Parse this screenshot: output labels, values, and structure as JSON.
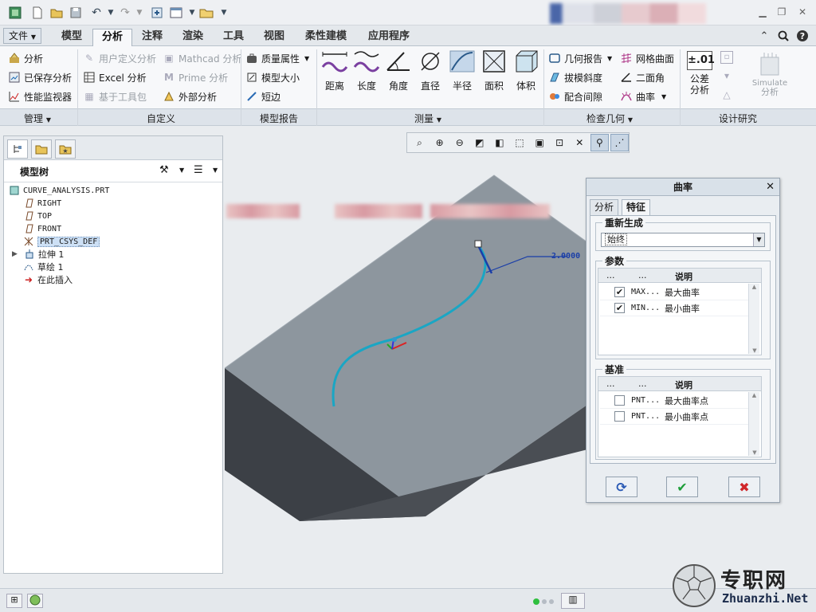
{
  "ribbon": {
    "file_label": "文件",
    "file_arrow": "▼",
    "tabs": [
      "模型",
      "分析",
      "注释",
      "渲染",
      "工具",
      "视图",
      "柔性建模",
      "应用程序"
    ],
    "manage": {
      "items": [
        "分析",
        "已保存分析",
        "性能监视器"
      ],
      "group_label": "管理"
    },
    "custom": {
      "items_col1": [
        "用户定义分析",
        "Excel 分析",
        "基于工具包"
      ],
      "items_col2": [
        "Mathcad 分析",
        "Prime 分析",
        "外部分析"
      ],
      "group_label": "自定义"
    },
    "model_report": {
      "items": [
        "质量属性",
        "模型大小",
        "短边"
      ],
      "group_label": "模型报告"
    },
    "measure": {
      "buttons": [
        "距离",
        "长度",
        "角度",
        "直径",
        "半径",
        "面积",
        "体积"
      ],
      "group_label": "测量"
    },
    "inspect": {
      "items_col1": [
        "几何报告",
        "拔模斜度",
        "配合间隙"
      ],
      "items_col2": [
        "网格曲面",
        "二面角",
        "曲率"
      ],
      "group_label": "检查几何"
    },
    "design": {
      "tolerance_icon": "±.01",
      "tolerance_label": "公差分析",
      "simulate_label": "Simulate",
      "simulate_sub": "分析",
      "group_label": "设计研究"
    }
  },
  "model_tree": {
    "title": "模型树",
    "items": [
      "CURVE_ANALYSIS.PRT",
      "RIGHT",
      "TOP",
      "FRONT",
      "PRT_CSYS_DEF",
      "拉伸 1",
      "草绘 1",
      "在此插入"
    ]
  },
  "graphics": {
    "dimension_value": "2.0000"
  },
  "dialog": {
    "title": "曲率",
    "tabs": [
      "分析",
      "特征"
    ],
    "regen_legend": "重新生成",
    "regen_value": "始终",
    "params_legend": "参数",
    "params_header": [
      "...",
      "...",
      "说明"
    ],
    "params_rows": [
      {
        "name": "MAX...",
        "desc": "最大曲率",
        "checked": true
      },
      {
        "name": "MIN...",
        "desc": "最小曲率",
        "checked": true
      }
    ],
    "datum_legend": "基准",
    "datum_header": [
      "...",
      "...",
      "说明"
    ],
    "datum_rows": [
      {
        "name": "PNT...",
        "desc": "最大曲率点",
        "checked": false
      },
      {
        "name": "PNT...",
        "desc": "最小曲率点",
        "checked": false
      }
    ],
    "check_mark": "✔"
  },
  "watermark": {
    "cn": "专职网",
    "url": "Zhuanzhi.Net"
  },
  "colors": {
    "accent": "#0f6cbd",
    "curve": "#1aa6c4",
    "ok_green": "#1e9e3a",
    "cancel_red": "#d0262a",
    "block_top": "#8d969e",
    "block_side": "#4a4e54"
  }
}
